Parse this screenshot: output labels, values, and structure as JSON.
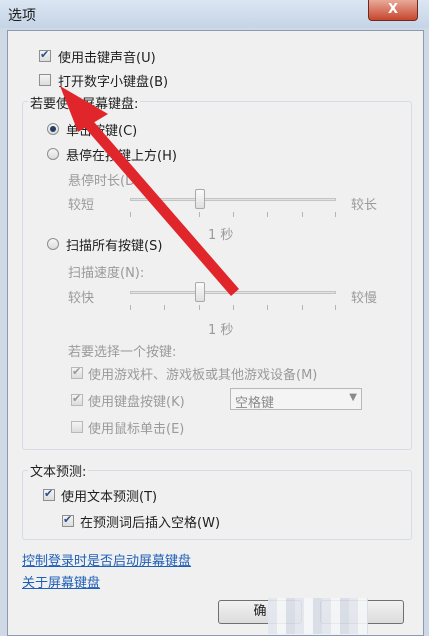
{
  "window": {
    "title": "选项",
    "close_label": "X"
  },
  "options": {
    "click_sound": {
      "label": "使用击键声音",
      "hotkey": "(U)",
      "checked": true
    },
    "numpad": {
      "label": "打开数字小键盘",
      "hotkey": "(B)",
      "checked": false
    }
  },
  "usage_group": {
    "label": "若要使用屏幕键盘:",
    "click_keys": {
      "label": "单击按键",
      "hotkey": "(C)",
      "selected": true
    },
    "hover_keys": {
      "label": "悬停在按键上方",
      "hotkey": "(H)",
      "selected": false
    },
    "hover_duration": {
      "label": "悬停时长",
      "hotkey": "(D):",
      "min_label": "较短",
      "max_label": "较长",
      "value_text": "1 秒"
    },
    "scan_keys": {
      "label": "扫描所有按键",
      "hotkey": "(S)",
      "selected": false
    },
    "scan_speed": {
      "label": "扫描速度",
      "hotkey": "(N):",
      "min_label": "较快",
      "max_label": "较慢",
      "value_text": "1 秒"
    },
    "select_key_label": "若要选择一个按键:",
    "use_gamepad": {
      "label": "使用游戏杆、游戏板或其他游戏设备",
      "hotkey": "(M)",
      "checked": true
    },
    "use_keyboard_key": {
      "label": "使用键盘按键",
      "hotkey": "(K)",
      "checked": true,
      "selected_key": "空格键"
    },
    "use_mouse_click": {
      "label": "使用鼠标单击",
      "hotkey": "(E)",
      "checked": false
    }
  },
  "prediction_group": {
    "label": "文本预测:",
    "use_prediction": {
      "label": "使用文本预测",
      "hotkey": "(T)",
      "checked": true
    },
    "insert_space": {
      "label": "在预测词后插入空格",
      "hotkey": "(W)",
      "checked": true
    }
  },
  "links": {
    "startup": "控制登录时是否启动屏幕键盘",
    "about": "关于屏幕键盘"
  },
  "buttons": {
    "ok": "确",
    "cancel": "取消"
  },
  "colors": {
    "arrow": "#e0262b",
    "link": "#1f5fb8",
    "disabled_text": "#9a9a9a"
  }
}
